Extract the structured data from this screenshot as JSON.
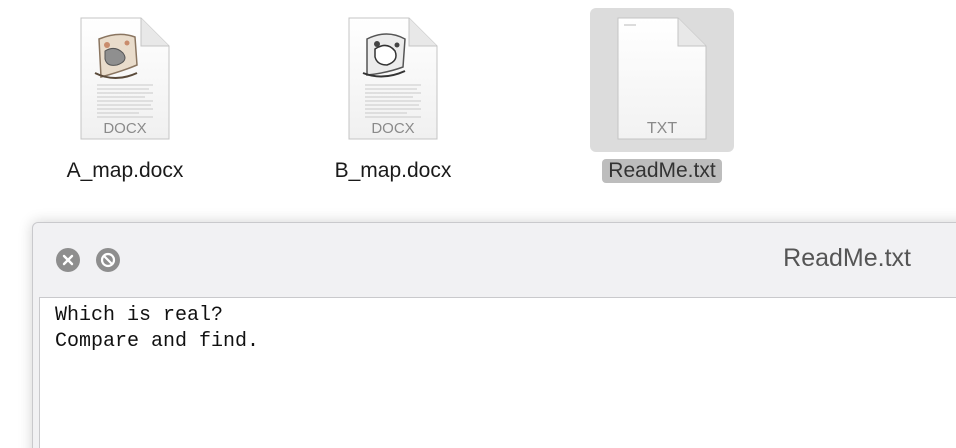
{
  "files": [
    {
      "name": "A_map.docx",
      "badge": "DOCX",
      "icon": "docx-map-icon",
      "selected": false
    },
    {
      "name": "B_map.docx",
      "badge": "DOCX",
      "icon": "docx-map-icon",
      "selected": false
    },
    {
      "name": "ReadMe.txt",
      "badge": "TXT",
      "icon": "txt-file-icon",
      "selected": true
    }
  ],
  "viewer": {
    "title": "ReadMe.txt",
    "buttons": [
      "close-icon",
      "no-entry-icon"
    ],
    "content_lines": [
      "Which is real?",
      "Compare and find."
    ]
  },
  "colors": {
    "selection_bg": "#dcdcdc",
    "label_selection_bg": "#bdbdbd",
    "window_bg": "#f1f1f3",
    "button_gray": "#8e8e8e"
  }
}
